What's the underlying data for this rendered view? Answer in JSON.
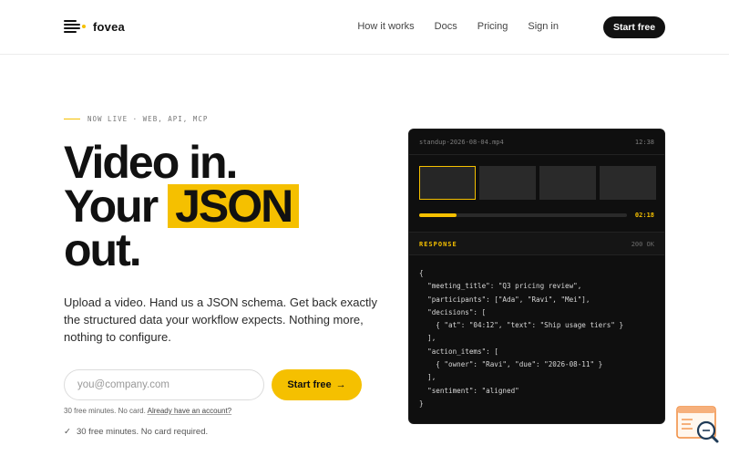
{
  "nav": {
    "brand": "fovea",
    "links": [
      "How it works",
      "Docs",
      "Pricing",
      "Sign in"
    ],
    "cta": "Start free"
  },
  "hero": {
    "eyebrow": "NOW LIVE · WEB, API, MCP",
    "headline_line1": "Video in.",
    "headline_line2_pre": "Your",
    "headline_line2_hl": "JSON",
    "headline_line3": "out.",
    "subtext": "Upload a video. Hand us a JSON schema. Get back exactly the structured data your workflow expects. Nothing more, nothing to configure.",
    "email_placeholder": "you@company.com",
    "cta": "Start free",
    "cta_arrow": "→",
    "fine_print": "30 free minutes. No card.",
    "fine_link": "Already have an account?",
    "check_mark": "✓",
    "check_note": "30 free minutes. No card required."
  },
  "panel": {
    "filename": "standup-2026-08-04.mp4",
    "duration": "12:38",
    "progress_fraction": 0.18,
    "progress_time": "02:18",
    "response_label": "RESPONSE",
    "response_status": "200 OK",
    "code_lines": [
      "{",
      "  \"meeting_title\": \"Q3 pricing review\",",
      "  \"participants\": [\"Ada\", \"Ravi\", \"Mei\"],",
      "  \"decisions\": [",
      "    { \"at\": \"04:12\", \"text\": \"Ship usage tiers\" }",
      "  ],",
      "  \"action_items\": [",
      "    { \"owner\": \"Ravi\", \"due\": \"2026-08-11\" }",
      "  ],",
      "  \"sentiment\": \"aligned\"",
      "}"
    ]
  },
  "colors": {
    "accent": "#f5c000",
    "ink": "#111111",
    "panel_bg": "#0f0f0f"
  },
  "icons": {
    "logo": "fovea-logo-icon",
    "arrow": "arrow-right-icon",
    "check": "check-icon",
    "corner": "search-document-icon"
  }
}
